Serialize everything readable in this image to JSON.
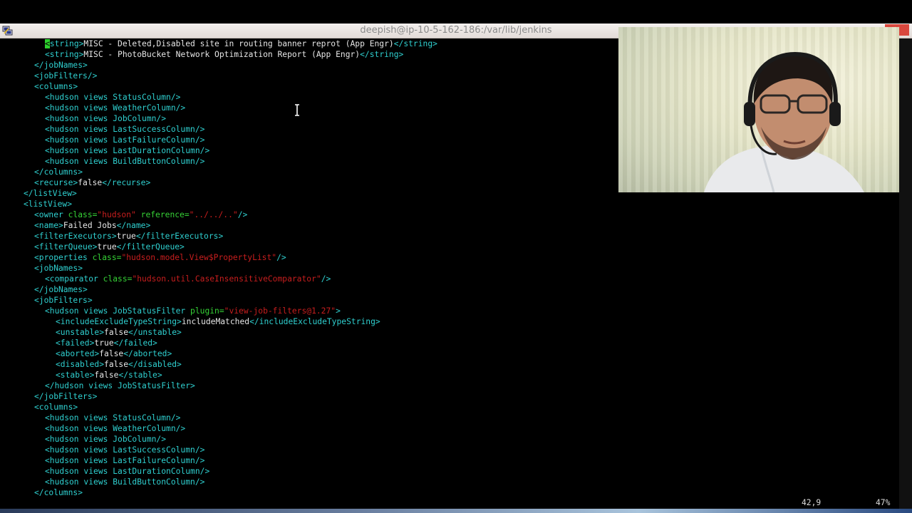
{
  "window": {
    "title": "deepish@ip-10-5-162-186:/var/lib/jenkins",
    "close_label": "✕"
  },
  "editor": {
    "lines": [
      [
        [
          "tag",
          "<string>"
        ],
        [
          "txt",
          "MISC - Deleted,Disabled site in routing banner reprot (App Engr)"
        ],
        [
          "tag",
          "</string>"
        ]
      ],
      [
        [
          "tag",
          "<string>"
        ],
        [
          "txt",
          "MISC - PhotoBucket Network Optimization Report (App Engr)"
        ],
        [
          "tag",
          "</string>"
        ]
      ],
      [
        [
          "tag",
          "</jobNames>"
        ]
      ],
      [
        [
          "tag",
          "<jobFilters/>"
        ]
      ],
      [
        [
          "tag",
          "<columns>"
        ]
      ],
      [
        [
          "tag",
          "<hudson views StatusColumn/>"
        ]
      ],
      [
        [
          "tag",
          "<hudson views WeatherColumn/>"
        ]
      ],
      [
        [
          "tag",
          "<hudson views JobColumn/>"
        ]
      ],
      [
        [
          "tag",
          "<hudson views LastSuccessColumn/>"
        ]
      ],
      [
        [
          "tag",
          "<hudson views LastFailureColumn/>"
        ]
      ],
      [
        [
          "tag",
          "<hudson views LastDurationColumn/>"
        ]
      ],
      [
        [
          "tag",
          "<hudson views BuildButtonColumn/>"
        ]
      ],
      [
        [
          "tag",
          "</columns>"
        ]
      ],
      [
        [
          "tag",
          "<recurse>"
        ],
        [
          "txt",
          "false"
        ],
        [
          "tag",
          "</recurse>"
        ]
      ],
      [
        [
          "tag",
          "</listView>"
        ]
      ],
      [
        [
          "tag",
          "<listView>"
        ]
      ],
      [
        [
          "tag",
          "<owner "
        ],
        [
          "attr",
          "class="
        ],
        [
          "val",
          "\"hudson\""
        ],
        [
          "attr",
          " reference="
        ],
        [
          "val",
          "\"../../..\""
        ],
        [
          "tag",
          "/>"
        ]
      ],
      [
        [
          "tag",
          "<name>"
        ],
        [
          "txt",
          "Failed Jobs"
        ],
        [
          "tag",
          "</name>"
        ]
      ],
      [
        [
          "tag",
          "<filterExecutors>"
        ],
        [
          "txt",
          "true"
        ],
        [
          "tag",
          "</filterExecutors>"
        ]
      ],
      [
        [
          "tag",
          "<filterQueue>"
        ],
        [
          "txt",
          "true"
        ],
        [
          "tag",
          "</filterQueue>"
        ]
      ],
      [
        [
          "tag",
          "<properties "
        ],
        [
          "attr",
          "class="
        ],
        [
          "val",
          "\"hudson.model.View$PropertyList\""
        ],
        [
          "tag",
          "/>"
        ]
      ],
      [
        [
          "tag",
          "<jobNames>"
        ]
      ],
      [
        [
          "tag",
          "<comparator "
        ],
        [
          "attr",
          "class="
        ],
        [
          "val",
          "\"hudson.util.CaseInsensitiveComparator\""
        ],
        [
          "tag",
          "/>"
        ]
      ],
      [
        [
          "tag",
          "</jobNames>"
        ]
      ],
      [
        [
          "tag",
          "<jobFilters>"
        ]
      ],
      [
        [
          "tag",
          "<hudson views JobStatusFilter "
        ],
        [
          "attr",
          "plugin="
        ],
        [
          "val",
          "\"view-job-filters@1.27\""
        ],
        [
          "tag",
          ">"
        ]
      ],
      [
        [
          "tag",
          "<includeExcludeTypeString>"
        ],
        [
          "txt",
          "includeMatched"
        ],
        [
          "tag",
          "</includeExcludeTypeString>"
        ]
      ],
      [
        [
          "tag",
          "<unstable>"
        ],
        [
          "txt",
          "false"
        ],
        [
          "tag",
          "</unstable>"
        ]
      ],
      [
        [
          "tag",
          "<failed>"
        ],
        [
          "txt",
          "true"
        ],
        [
          "tag",
          "</failed>"
        ]
      ],
      [
        [
          "tag",
          "<aborted>"
        ],
        [
          "txt",
          "false"
        ],
        [
          "tag",
          "</aborted>"
        ]
      ],
      [
        [
          "tag",
          "<disabled>"
        ],
        [
          "txt",
          "false"
        ],
        [
          "tag",
          "</disabled>"
        ]
      ],
      [
        [
          "tag",
          "<stable>"
        ],
        [
          "txt",
          "false"
        ],
        [
          "tag",
          "</stable>"
        ]
      ],
      [
        [
          "tag",
          "</hudson views JobStatusFilter>"
        ]
      ],
      [
        [
          "tag",
          "</jobFilters>"
        ]
      ],
      [
        [
          "tag",
          "<columns>"
        ]
      ],
      [
        [
          "tag",
          "<hudson views StatusColumn/>"
        ]
      ],
      [
        [
          "tag",
          "<hudson views WeatherColumn/>"
        ]
      ],
      [
        [
          "tag",
          "<hudson views JobColumn/>"
        ]
      ],
      [
        [
          "tag",
          "<hudson views LastSuccessColumn/>"
        ]
      ],
      [
        [
          "tag",
          "<hudson views LastFailureColumn/>"
        ]
      ],
      [
        [
          "tag",
          "<hudson views LastDurationColumn/>"
        ]
      ],
      [
        [
          "tag",
          "<hudson views BuildButtonColumn/>"
        ]
      ],
      [
        [
          "tag",
          "</columns>"
        ]
      ]
    ]
  },
  "status": {
    "cursor_position": "42,9",
    "scroll_percent": "47%"
  },
  "colors": {
    "tag": "#2fd0d0",
    "attr": "#36d236",
    "value": "#c81e1e",
    "text": "#e6e6e6",
    "cursor": "#2dd12d"
  }
}
